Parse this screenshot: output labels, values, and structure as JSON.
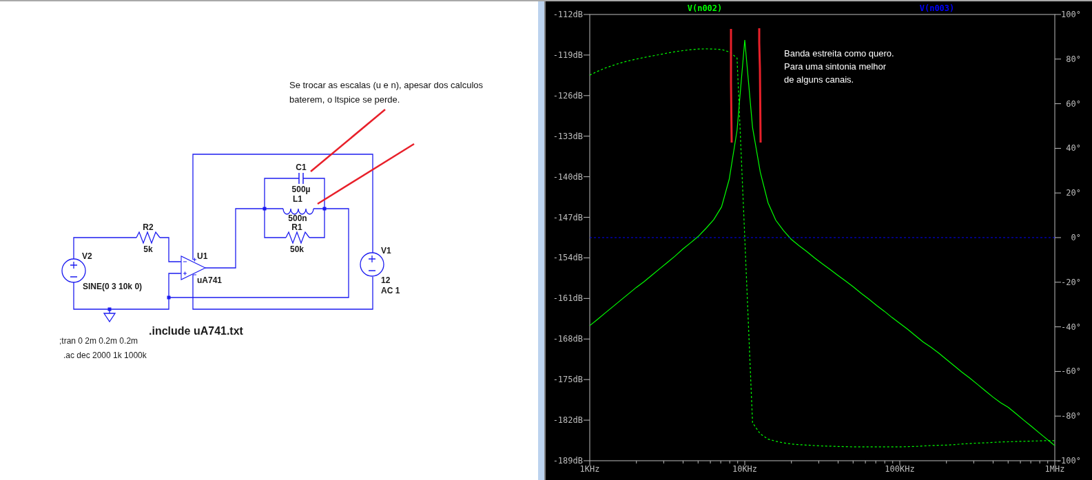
{
  "schematic": {
    "comment": "Se trocar as escalas (u e n), apesar dos calculos baterem, o ltspice se perde.",
    "components": [
      {
        "kind": "voltage_source",
        "ref": "V2",
        "values": [
          "SINE(0 3 10k 0)"
        ]
      },
      {
        "kind": "resistor",
        "ref": "R2",
        "values": [
          "5k"
        ]
      },
      {
        "kind": "opamp",
        "ref": "U1",
        "values": [
          "uA741"
        ]
      },
      {
        "kind": "capacitor",
        "ref": "C1",
        "values": [
          "500µ"
        ]
      },
      {
        "kind": "inductor",
        "ref": "L1",
        "values": [
          "500n"
        ]
      },
      {
        "kind": "resistor",
        "ref": "R1",
        "values": [
          "50k"
        ]
      },
      {
        "kind": "voltage_source",
        "ref": "V1",
        "values": [
          "12",
          "AC 1"
        ]
      }
    ],
    "directives": [
      {
        "kind": "include",
        "text": ".include uA741.txt"
      },
      {
        "kind": "analysis",
        "text": ";tran 0 2m 0.2m 0.2m"
      },
      {
        "kind": "analysis",
        "text": ".ac dec 2000 1k 1000k"
      }
    ]
  },
  "plot": {
    "note": "Banda estreita como quero. Para uma sintonia melhor de alguns canais.",
    "chart_data": {
      "type": "line",
      "categories": [
        "1KHz",
        null,
        null,
        null,
        null,
        null,
        null,
        null,
        null,
        null,
        null,
        null,
        null,
        null,
        null,
        null,
        null,
        null,
        null,
        null,
        "10KHz",
        null,
        null,
        null,
        null,
        null,
        null,
        null,
        null,
        null,
        null,
        null,
        null,
        null,
        null,
        null,
        null,
        null,
        null,
        null,
        "100KHz",
        null,
        null,
        null,
        null,
        null,
        null,
        null,
        null,
        null,
        null,
        null,
        null,
        null,
        null,
        null,
        null,
        null,
        null,
        null,
        "1MHz"
      ],
      "ylim": [
        -189,
        -112
      ],
      "yticks": [
        {
          "value": -112,
          "label": "-112dB"
        },
        {
          "value": -119,
          "label": "-119dB"
        },
        {
          "value": -126,
          "label": "-126dB"
        },
        {
          "value": -133,
          "label": "-133dB"
        },
        {
          "value": -140,
          "label": "-140dB"
        },
        {
          "value": -147,
          "label": "-147dB"
        },
        {
          "value": -154,
          "label": "-154dB"
        },
        {
          "value": -161,
          "label": "-161dB"
        },
        {
          "value": -168,
          "label": "-168dB"
        },
        {
          "value": -175,
          "label": "-175dB"
        },
        {
          "value": -182,
          "label": "-182dB"
        },
        {
          "value": -189,
          "label": "-189dB"
        }
      ],
      "y2lim": [
        -100,
        100
      ],
      "y2ticks": [
        {
          "value": 100,
          "label": "100°"
        },
        {
          "value": 80,
          "label": "80°"
        },
        {
          "value": 60,
          "label": "60°"
        },
        {
          "value": 40,
          "label": "40°"
        },
        {
          "value": 20,
          "label": "20°"
        },
        {
          "value": 0,
          "label": "0°"
        },
        {
          "value": -20,
          "label": "-20°"
        },
        {
          "value": -40,
          "label": "-40°"
        },
        {
          "value": -60,
          "label": "-60°"
        },
        {
          "value": -80,
          "label": "-80°"
        },
        {
          "value": -100,
          "label": "-100°"
        }
      ],
      "series": [
        {
          "name": "V(n002)",
          "color": "#00ff00",
          "values": [
            -165.7,
            -164.6,
            -163.5,
            -162.4,
            -161.3,
            -160.2,
            -159.1,
            -158.1,
            -157,
            -155.9,
            -154.8,
            -153.7,
            -152.5,
            -151.4,
            -150.3,
            -148.9,
            -147.4,
            -145.2,
            -140.4,
            -132,
            -116.4,
            -131.5,
            -139.2,
            -144.5,
            -147.5,
            -149.3,
            -150.8,
            -151.9,
            -152.9,
            -154,
            -155,
            -156,
            -157,
            -158,
            -159,
            -160.1,
            -161.1,
            -162.2,
            -163.2,
            -164.3,
            -165.3,
            -166.3,
            -167.4,
            -168.5,
            -169.4,
            -170.4,
            -171.5,
            -172.6,
            -173.7,
            -174.7,
            -175.8,
            -176.9,
            -178,
            -179,
            -179.8,
            -180.9,
            -182,
            -183.1,
            -184.2,
            -185.3,
            -186.4
          ]
        },
        {
          "color": "#00ff00",
          "axis": "y2",
          "line_style": "dashed",
          "values": [
            72.8,
            74.5,
            76,
            77.2,
            78.3,
            79.2,
            80,
            80.7,
            81.4,
            82,
            82.7,
            83.3,
            83.8,
            84.2,
            84.5,
            84.6,
            84.5,
            84.3,
            83.2,
            80.5,
            0,
            -83,
            -88,
            -90.3,
            -91.3,
            -92,
            -92.5,
            -92.8,
            -93,
            -93.2,
            -93.4,
            -93.5,
            -93.6,
            -93.7,
            -93.8,
            -93.8,
            -93.8,
            -93.8,
            -93.8,
            -93.8,
            -93.8,
            -93.7,
            -93.6,
            -93.4,
            -93.2,
            -93.1,
            -93,
            -92.8,
            -92.5,
            -92.3,
            -92.1,
            -92,
            -91.8,
            -91.6,
            -91.5,
            -91.4,
            -91.3,
            -91.2,
            -91.1,
            -91,
            -91
          ]
        },
        {
          "name": "V(n003)",
          "color": "#0000ff",
          "axis": "y2",
          "line_style": "dashed",
          "values": [
            0,
            0,
            0,
            0,
            0,
            0,
            0,
            0,
            0,
            0,
            0,
            0,
            0,
            0,
            0,
            0,
            0,
            0,
            0,
            0,
            0,
            0,
            0,
            0,
            0,
            0,
            0,
            0,
            0,
            0,
            0,
            0,
            0,
            0,
            0,
            0,
            0,
            0,
            0,
            0,
            0,
            0,
            0,
            0,
            0,
            0,
            0,
            0,
            0,
            0,
            0,
            0,
            0,
            0,
            0,
            0,
            0,
            0,
            0,
            0,
            0
          ]
        }
      ]
    }
  }
}
